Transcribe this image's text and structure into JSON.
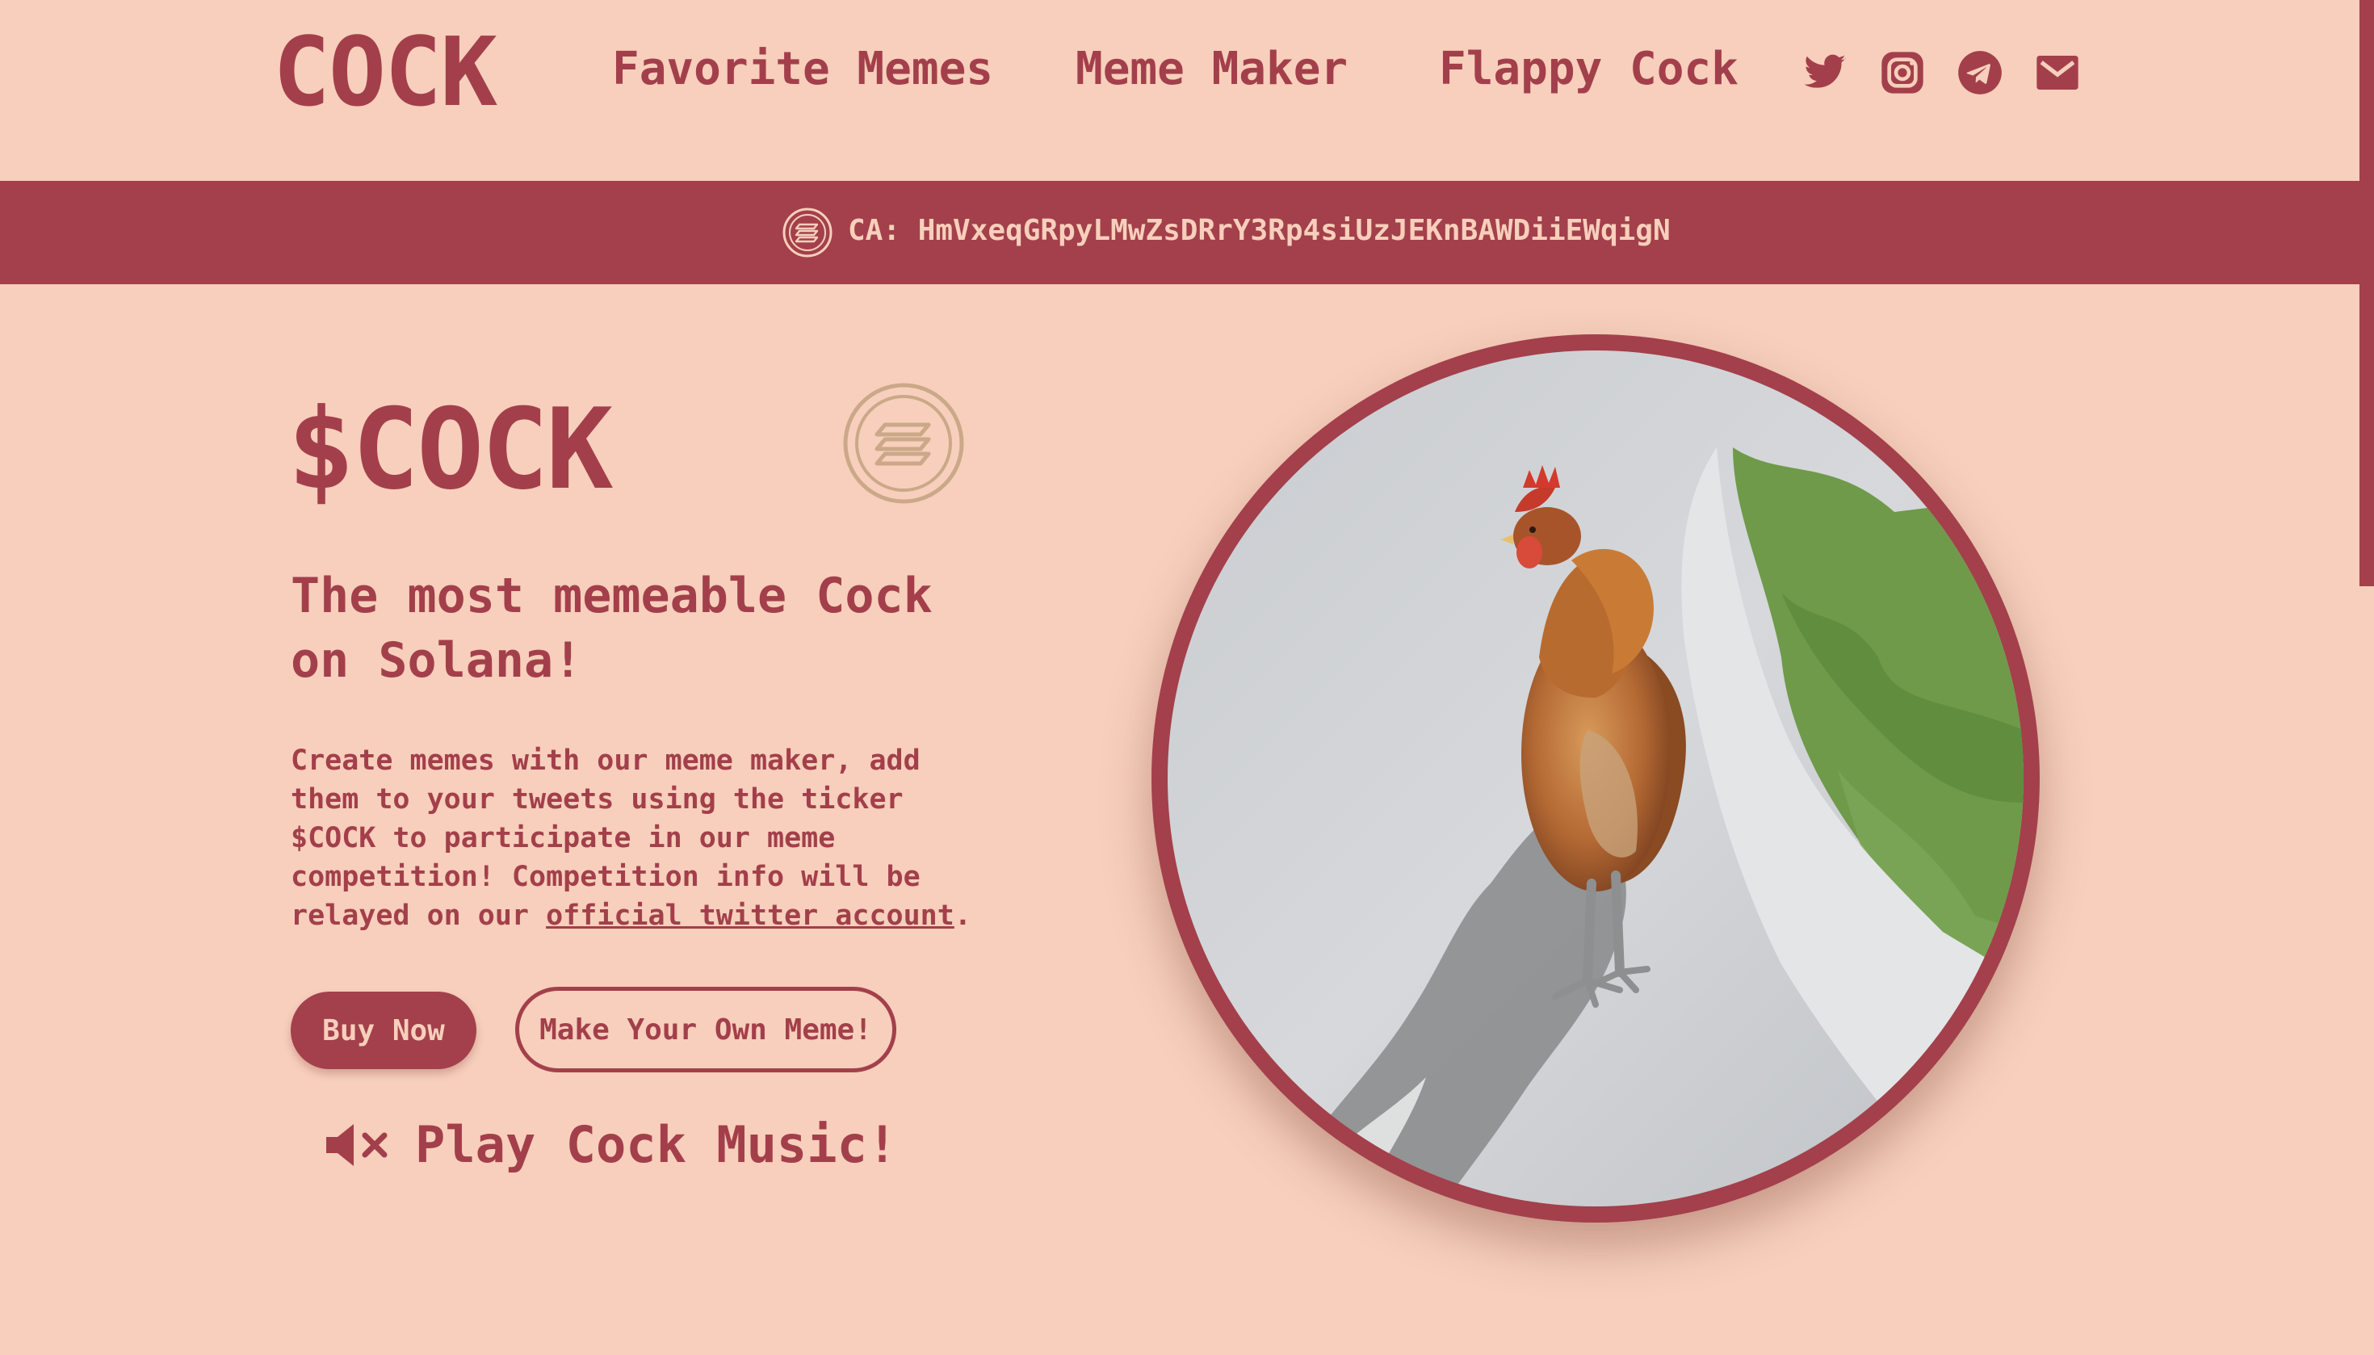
{
  "header": {
    "logo": "COCK",
    "nav": [
      {
        "label": "Favorite Memes"
      },
      {
        "label": "Meme Maker"
      },
      {
        "label": "Flappy Cock"
      }
    ],
    "socials": [
      {
        "icon": "twitter-icon"
      },
      {
        "icon": "instagram-icon"
      },
      {
        "icon": "telegram-icon"
      },
      {
        "icon": "mail-icon"
      }
    ]
  },
  "banner": {
    "contract_address": "CA: HmVxeqGRpyLMwZsDRrY3Rp4siUzJEKnBAWDiiEWqigN",
    "chain_icon": "solana-icon"
  },
  "hero": {
    "ticker": "$COCK",
    "tagline": "The most memeable Cock on Solana!",
    "description_prefix": "Create memes with our meme maker, add them to your tweets using the ticker $COCK to participate in our meme competition! Competition info will be relayed on our ",
    "description_link": "official twitter account",
    "description_suffix": ".",
    "buy_button": "Buy Now",
    "meme_button": "Make Your Own Meme!",
    "music_label": "Play Cock Music!",
    "music_icon": "speaker-muted-icon",
    "image": "rooster-photo"
  },
  "colors": {
    "background": "#f7cfbc",
    "accent": "#a3404b"
  }
}
